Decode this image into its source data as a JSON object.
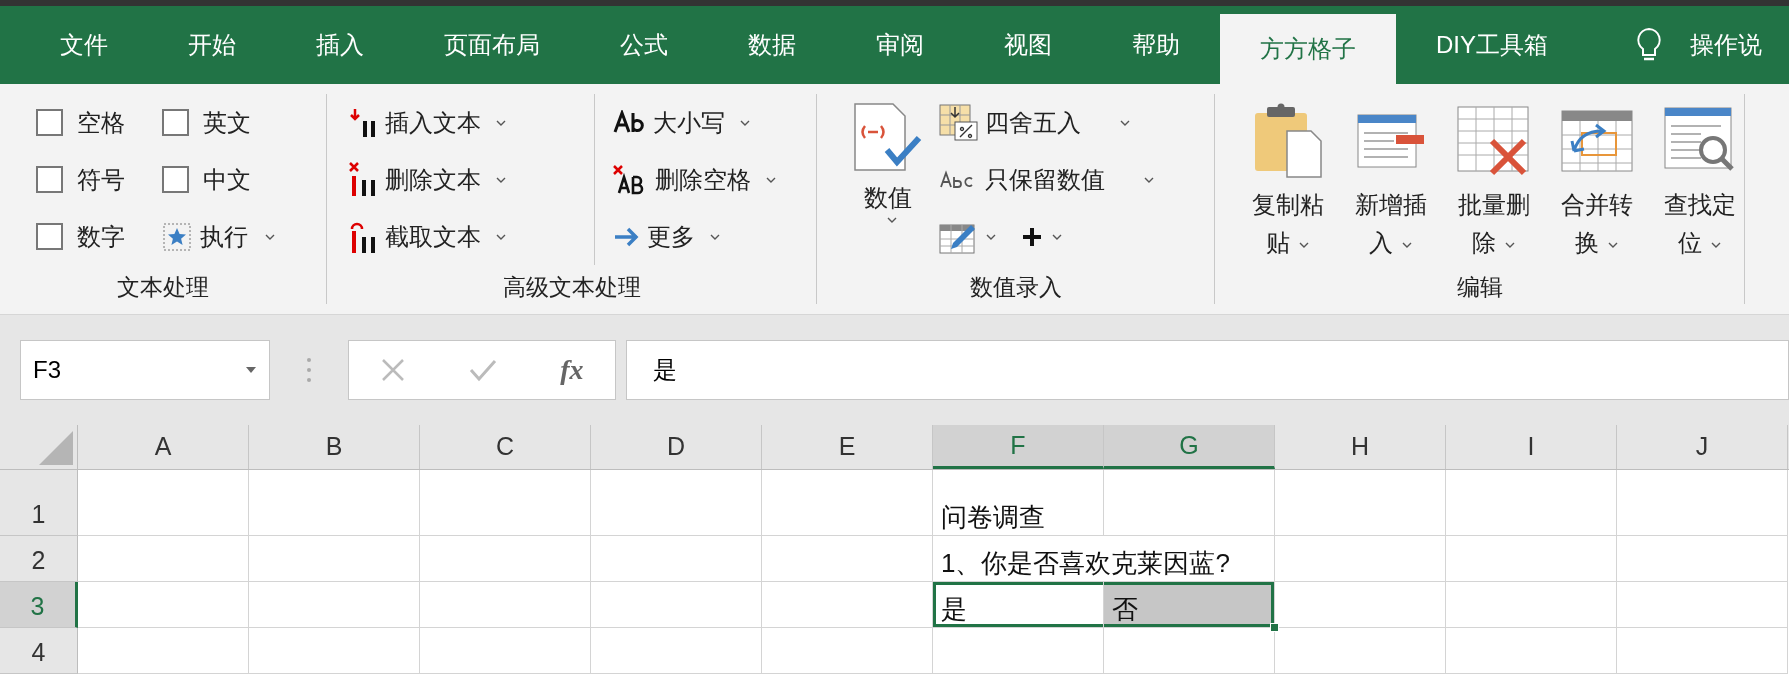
{
  "tabs": [
    {
      "label": "文件",
      "selected": false
    },
    {
      "label": "开始",
      "selected": false
    },
    {
      "label": "插入",
      "selected": false
    },
    {
      "label": "页面布局",
      "selected": false
    },
    {
      "label": "公式",
      "selected": false
    },
    {
      "label": "数据",
      "selected": false
    },
    {
      "label": "审阅",
      "selected": false
    },
    {
      "label": "视图",
      "selected": false
    },
    {
      "label": "帮助",
      "selected": false
    },
    {
      "label": "方方格子",
      "selected": true
    },
    {
      "label": "DIY工具箱",
      "selected": false
    }
  ],
  "tell_me": "操作说",
  "ribbon": {
    "text_group": {
      "label": "文本处理",
      "checkboxes": [
        {
          "label": "空格",
          "checked": false
        },
        {
          "label": "英文",
          "checked": false
        },
        {
          "label": "符号",
          "checked": false
        },
        {
          "label": "中文",
          "checked": false
        },
        {
          "label": "数字",
          "checked": false
        }
      ],
      "execute": "执行"
    },
    "advanced_group": {
      "label": "高级文本处理",
      "items": [
        {
          "label": "插入文本",
          "kind": "insert"
        },
        {
          "label": "删除文本",
          "kind": "delete"
        },
        {
          "label": "截取文本",
          "kind": "extract"
        },
        {
          "label": "大小写",
          "kind": "case"
        },
        {
          "label": "删除空格",
          "kind": "trim"
        },
        {
          "label": "更多",
          "kind": "more"
        }
      ]
    },
    "number_group": {
      "label": "数值录入",
      "big": "数值",
      "items": [
        {
          "label": "四舍五入",
          "kind": "round"
        },
        {
          "label": "只保留数值",
          "kind": "keep"
        }
      ]
    },
    "edit_group": {
      "label": "编辑",
      "buttons": [
        {
          "label": "复制粘贴",
          "kind": "paste"
        },
        {
          "label": "新增插入",
          "kind": "insert"
        },
        {
          "label": "批量删除",
          "kind": "delete"
        },
        {
          "label": "合并转换",
          "kind": "merge"
        },
        {
          "label": "查找定位",
          "kind": "find"
        }
      ]
    }
  },
  "formula_bar": {
    "name_box": "F3",
    "function_label": "fx",
    "value": "是"
  },
  "sheet": {
    "columns": [
      {
        "label": "A",
        "selected": false
      },
      {
        "label": "B",
        "selected": false
      },
      {
        "label": "C",
        "selected": false
      },
      {
        "label": "D",
        "selected": false
      },
      {
        "label": "E",
        "selected": false
      },
      {
        "label": "F",
        "selected": true
      },
      {
        "label": "G",
        "selected": true
      },
      {
        "label": "H",
        "selected": false
      },
      {
        "label": "I",
        "selected": false
      },
      {
        "label": "J",
        "selected": false
      }
    ],
    "rows": [
      {
        "label": "1",
        "selected": false
      },
      {
        "label": "2",
        "selected": false
      },
      {
        "label": "3",
        "selected": true
      },
      {
        "label": "4",
        "selected": false
      }
    ],
    "cells": [
      [
        {
          "selected": false
        },
        {
          "selected": false
        },
        {
          "selected": false
        },
        {
          "selected": false
        },
        {
          "selected": false
        },
        {
          "text": "问卷调查",
          "selected": false
        }
      ],
      [
        {
          "selected": false
        },
        {
          "selected": false
        },
        {
          "selected": false
        },
        {
          "selected": false
        },
        {
          "selected": false
        },
        {
          "text": "1、你是否喜欢克莱因蓝?",
          "selected": false
        }
      ],
      [
        {
          "selected": false
        },
        {
          "selected": false
        },
        {
          "selected": false
        },
        {
          "selected": false
        },
        {
          "selected": false
        },
        {
          "text": "是",
          "selected": true
        },
        {
          "text": "否",
          "selected": true,
          "color": "#c6c6c6"
        }
      ],
      [
        {
          "selected": false
        }
      ]
    ]
  }
}
